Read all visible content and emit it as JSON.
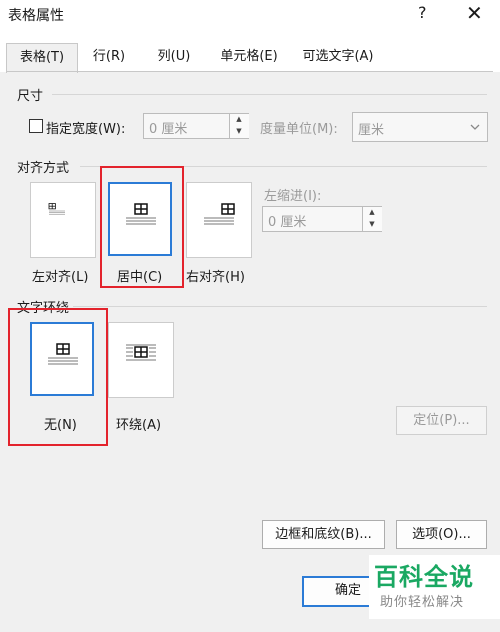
{
  "window": {
    "title": "表格属性",
    "help_label": "?",
    "close_label": "✕"
  },
  "tabs": [
    {
      "label": "表格(T)",
      "active": true
    },
    {
      "label": "行(R)",
      "active": false
    },
    {
      "label": "列(U)",
      "active": false
    },
    {
      "label": "单元格(E)",
      "active": false
    },
    {
      "label": "可选文字(A)",
      "active": false
    }
  ],
  "size": {
    "heading": "尺寸",
    "specify_width_label": "指定宽度(W):",
    "specify_width_checked": false,
    "width_value": "0 厘米",
    "measure_unit_label": "度量单位(M):",
    "measure_unit_value": "厘米"
  },
  "alignment": {
    "heading": "对齐方式",
    "options": [
      {
        "label": "左对齐(L)",
        "selected": false
      },
      {
        "label": "居中(C)",
        "selected": true
      },
      {
        "label": "右对齐(H)",
        "selected": false
      }
    ],
    "indent_label": "左缩进(I):",
    "indent_value": "0 厘米"
  },
  "wrapping": {
    "heading": "文字环绕",
    "options": [
      {
        "label": "无(N)",
        "selected": true
      },
      {
        "label": "环绕(A)",
        "selected": false
      }
    ],
    "position_button": "定位(P)..."
  },
  "buttons": {
    "borders_shading": "边框和底纹(B)...",
    "options": "选项(O)...",
    "ok": "确定"
  },
  "watermark": {
    "logo": "百科全说",
    "subtitle": "助你轻松解决"
  },
  "colors": {
    "accent": "#2b7bd6",
    "highlight": "#e3232c",
    "watermark": "#1aa862"
  }
}
